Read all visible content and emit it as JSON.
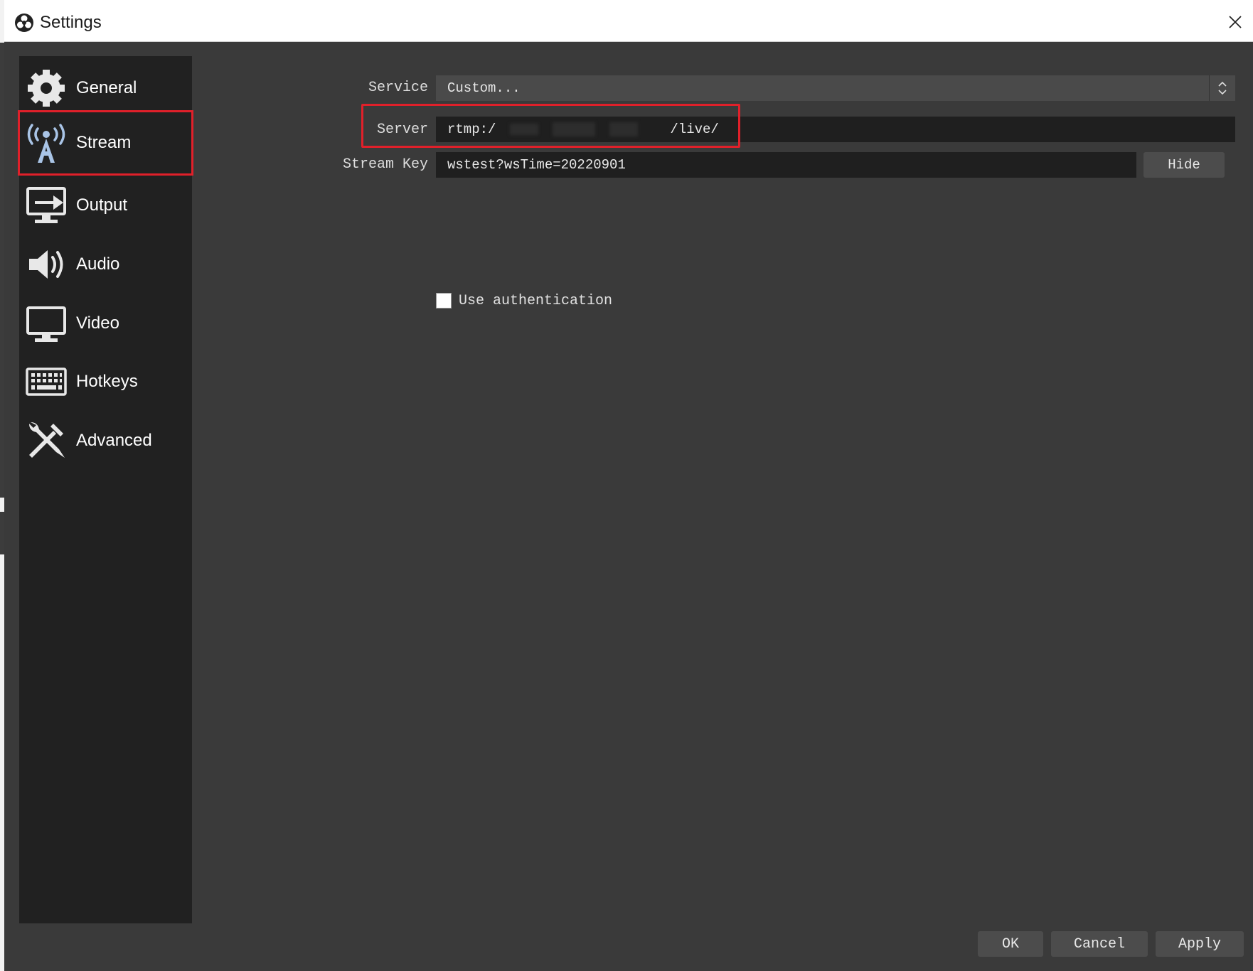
{
  "window": {
    "title": "Settings",
    "close_icon": "close-icon",
    "logo_icon": "obs-logo-icon"
  },
  "sidebar": {
    "items": [
      {
        "label": "General",
        "icon": "gear-icon"
      },
      {
        "label": "Stream",
        "icon": "broadcast-antenna-icon",
        "selected": true
      },
      {
        "label": "Output",
        "icon": "output-monitor-icon"
      },
      {
        "label": "Audio",
        "icon": "speaker-icon"
      },
      {
        "label": "Video",
        "icon": "monitor-icon"
      },
      {
        "label": "Hotkeys",
        "icon": "keyboard-icon"
      },
      {
        "label": "Advanced",
        "icon": "tools-icon"
      }
    ]
  },
  "stream": {
    "service_label": "Service",
    "service_value": "Custom...",
    "server_label": "Server",
    "server_value_prefix": "rtmp:/",
    "server_value_suffix": "/live/",
    "stream_key_label": "Stream Key",
    "stream_key_value": "wstest?wsTime=20220901",
    "hide_label": "Hide",
    "use_auth_label": "Use authentication",
    "use_auth_checked": false
  },
  "buttons": {
    "ok": "OK",
    "cancel": "Cancel",
    "apply": "Apply"
  },
  "colors": {
    "highlight": "#e0202a",
    "panel_bg": "#3a3a3a",
    "sidebar_bg": "#212121"
  }
}
